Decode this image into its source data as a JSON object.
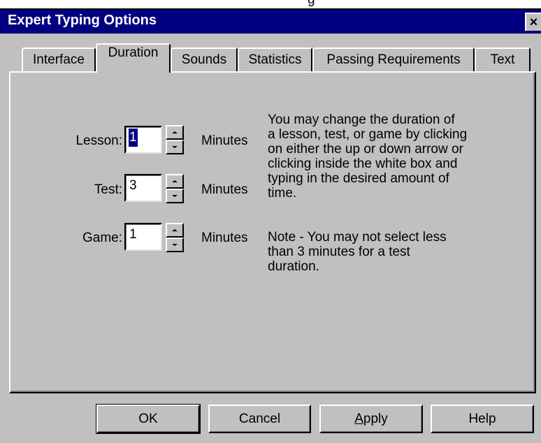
{
  "top_strip": {
    "text": "g"
  },
  "window": {
    "title": "Expert Typing Options",
    "close_glyph": "×"
  },
  "tabs": [
    {
      "label": "Interface"
    },
    {
      "label": "Duration"
    },
    {
      "label": "Sounds"
    },
    {
      "label": "Statistics"
    },
    {
      "label": "Passing Requirements"
    },
    {
      "label": "Text"
    }
  ],
  "active_tab": "Duration",
  "duration": {
    "lesson": {
      "label": "Lesson:",
      "value": "1",
      "unit": "Minutes"
    },
    "test": {
      "label": "Test:",
      "value": "3",
      "unit": "Minutes"
    },
    "game": {
      "label": "Game:",
      "value": "1",
      "unit": "Minutes"
    }
  },
  "description": {
    "line1": "You may change the duration of",
    "line2": "a lesson, test, or game by clicking",
    "line3": "on either the up or down arrow or",
    "line4": "clicking inside the white box and",
    "line5": "typing in the desired amount of",
    "line6": "time."
  },
  "note": {
    "line1": "Note - You may not select less",
    "line2": "than 3 minutes for a test",
    "line3": "duration."
  },
  "buttons": {
    "ok": "OK",
    "cancel": "Cancel",
    "apply_first": "A",
    "apply_rest": "pply",
    "help": "Help"
  },
  "icons": {
    "spinner_up": "up-arrow",
    "spinner_down": "down-arrow",
    "close": "close-x"
  }
}
